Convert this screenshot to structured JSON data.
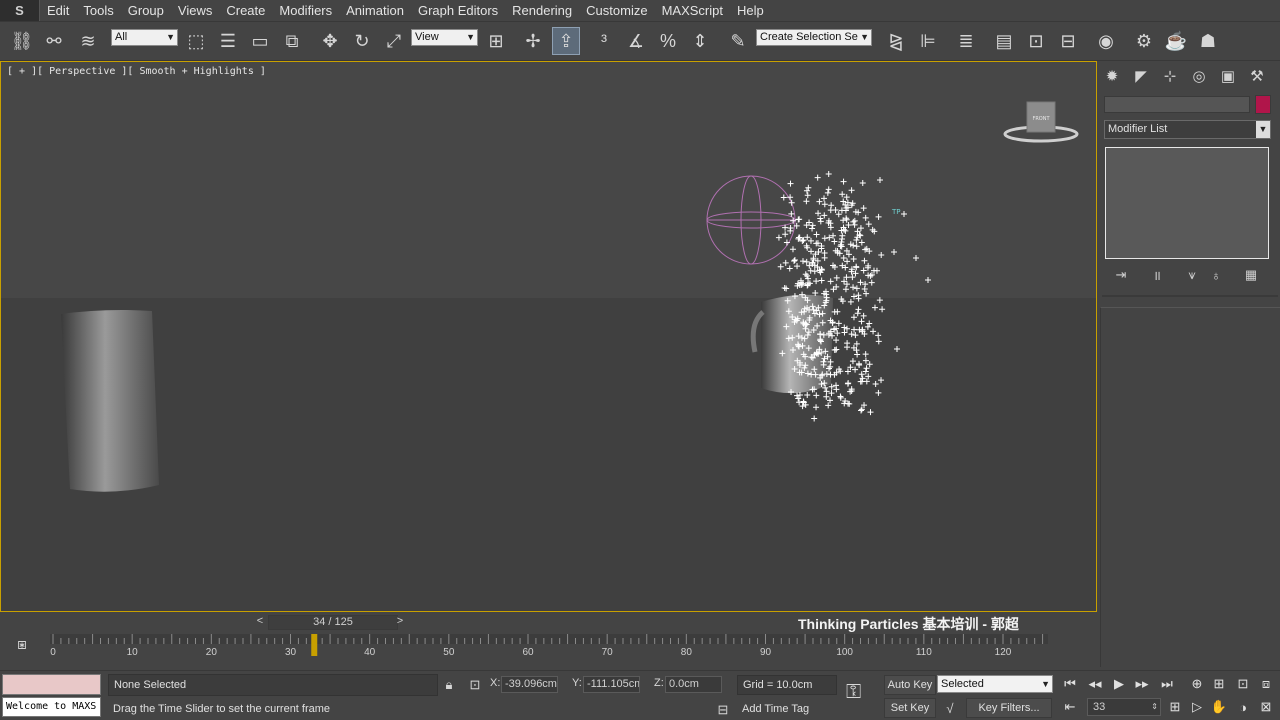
{
  "app": {
    "logo_text": "S"
  },
  "menu": [
    "Edit",
    "Tools",
    "Group",
    "Views",
    "Create",
    "Modifiers",
    "Animation",
    "Graph Editors",
    "Rendering",
    "Customize",
    "MAXScript",
    "Help"
  ],
  "toolbar": {
    "selection_filter": "All",
    "ref_coord": "View",
    "named_selection_placeholder": "Create Selection Se"
  },
  "viewport": {
    "label": "[ + ][ Perspective ][ Smooth + Highlights ]",
    "viewcube_label": "FRONT"
  },
  "command_panel": {
    "modifier_list": "Modifier List",
    "object_color": "#b0154a"
  },
  "timeline": {
    "frame_display": "34 / 125",
    "prev": "<",
    "next": ">",
    "current_frame": 33,
    "total_frames": 125,
    "tick_labels": [
      "0",
      "10",
      "20",
      "30",
      "40",
      "50",
      "60",
      "70",
      "80",
      "90",
      "100",
      "110",
      "120"
    ]
  },
  "watermark": "Thinking Particles 基本培训 - 郭超",
  "status": {
    "maxscript_text": "Welcome to MAXS",
    "selection": "None Selected",
    "prompt": "Drag the Time Slider to set the current frame",
    "x_label": "X:",
    "x_value": "-39.096cm",
    "y_label": "Y:",
    "y_value": "-111.105cm",
    "z_label": "Z:",
    "z_value": "0.0cm",
    "grid": "Grid = 10.0cm",
    "add_time_tag": "Add Time Tag",
    "auto_key": "Auto Key",
    "set_key": "Set Key",
    "key_mode": "Selected",
    "key_filters": "Key Filters...",
    "frame": "33"
  }
}
